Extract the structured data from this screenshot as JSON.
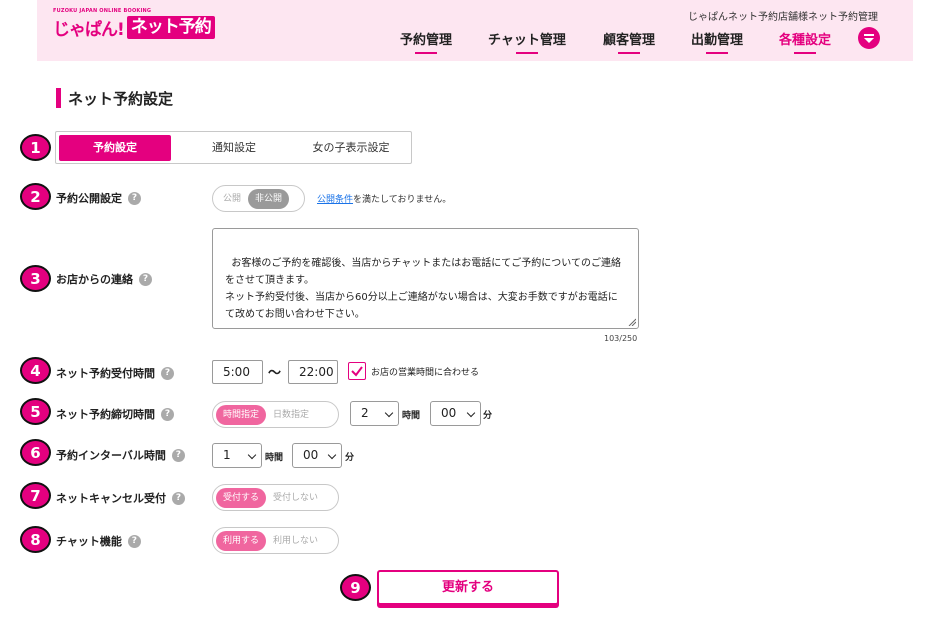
{
  "header": {
    "logo_small": "FUZOKU JAPAN ONLINE BOOKING",
    "logo_brand": "じゃぱん!",
    "logo_product": "ネット予約",
    "store_name": "じゃぱんネット予約店舗様ネット予約管理",
    "nav": [
      {
        "label": "予約管理",
        "active": false
      },
      {
        "label": "チャット管理",
        "active": false
      },
      {
        "label": "顧客管理",
        "active": false
      },
      {
        "label": "出勤管理",
        "active": false
      },
      {
        "label": "各種設定",
        "active": true
      }
    ],
    "menu_icon": "dropdown-menu-icon"
  },
  "page": {
    "title": "ネット予約設定"
  },
  "badges": [
    "1",
    "2",
    "3",
    "4",
    "5",
    "6",
    "7",
    "8",
    "9"
  ],
  "tabs": [
    {
      "label": "予約設定",
      "active": true
    },
    {
      "label": "通知設定",
      "active": false
    },
    {
      "label": "女の子表示設定",
      "active": false
    }
  ],
  "help_glyph": "?",
  "form": {
    "publish": {
      "label": "予約公開設定",
      "options": [
        "公開",
        "非公開"
      ],
      "selected": "非公開",
      "notice_link": "公開条件",
      "notice_text": "を満たしておりません。"
    },
    "message": {
      "label": "お店からの連絡",
      "value": "お客様のご予約を確認後、当店からチャットまたはお電話にてご予約についてのご連絡をさせて頂きます。\nネット予約受付後、当店から60分以上ご連絡がない場合は、大変お手数ですがお電話にて改めてお問い合わせ下さい。",
      "counter": "103/250"
    },
    "hours": {
      "label": "ネット予約受付時間",
      "start": "5:00",
      "separator": "〜",
      "end": "22:00",
      "match_label": "お店の営業時間に合わせる",
      "match_checked": true
    },
    "deadline": {
      "label": "ネット予約締切時間",
      "options": [
        "時間指定",
        "日数指定"
      ],
      "selected": "時間指定",
      "hours": "2",
      "hours_unit": "時間",
      "minutes": "00",
      "minutes_unit": "分"
    },
    "interval": {
      "label": "予約インターバル時間",
      "hours": "1",
      "hours_unit": "時間",
      "minutes": "00",
      "minutes_unit": "分"
    },
    "cancel": {
      "label": "ネットキャンセル受付",
      "options": [
        "受付する",
        "受付しない"
      ],
      "selected": "受付する"
    },
    "chat": {
      "label": "チャット機能",
      "options": [
        "利用する",
        "利用しない"
      ],
      "selected": "利用する"
    }
  },
  "submit_label": "更新する",
  "colors": {
    "accent": "#e4007f",
    "header_bg": "#fde6f1",
    "toggle_on": "#f0669f",
    "link": "#1a73e8"
  }
}
